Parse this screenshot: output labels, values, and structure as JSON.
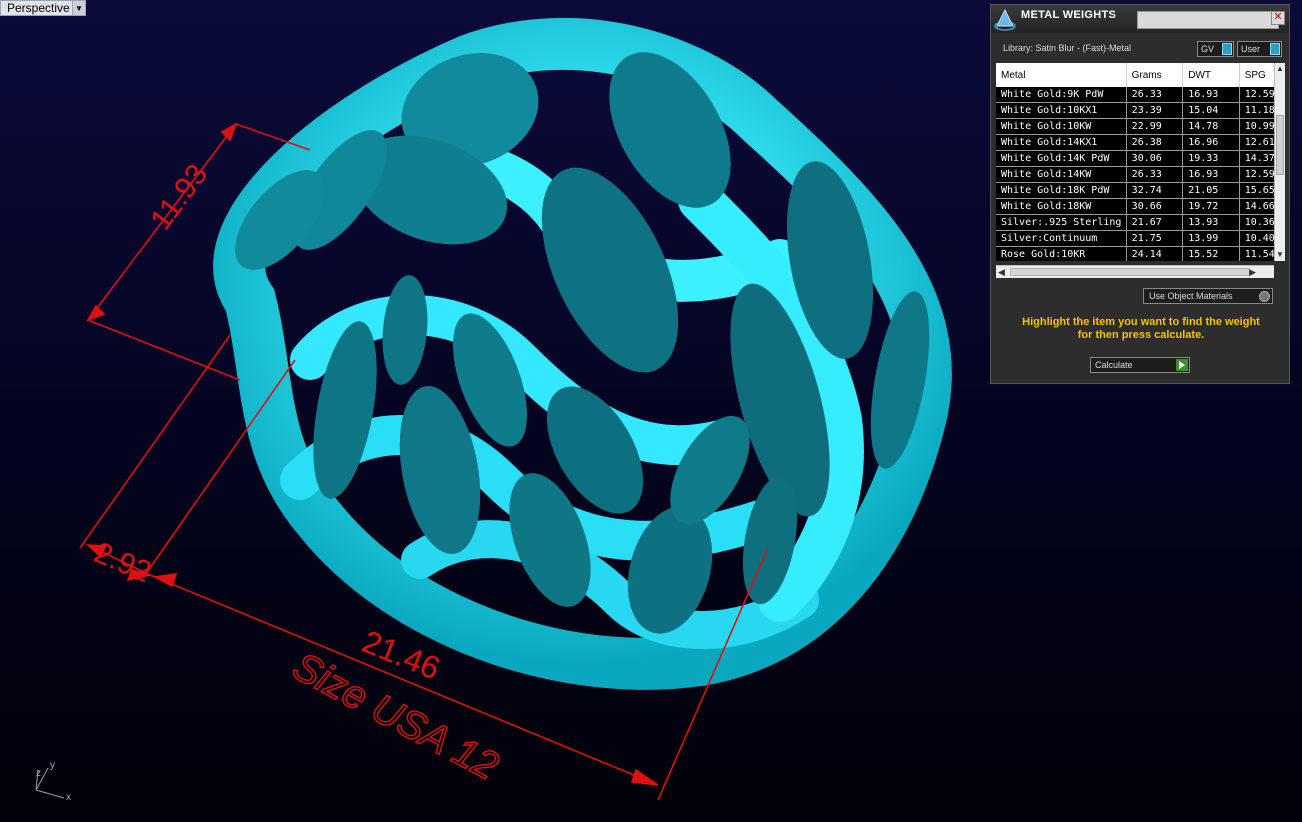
{
  "viewport": {
    "name": "Perspective",
    "dimensions": [
      "11.93",
      "2.92",
      "21.46"
    ],
    "size_note": "Size USA 12",
    "axes": {
      "x": "x",
      "y": "y",
      "z": "z"
    }
  },
  "panel": {
    "title": "METAL WEIGHTS",
    "close": "✕",
    "library": "Library: Satin Blur - (Fast)-Metal",
    "toggles": {
      "gv": "GV",
      "user": "User"
    },
    "table": {
      "headers": [
        "Metal",
        "Grams",
        "DWT",
        "SPG"
      ],
      "rows": [
        [
          "White Gold:9K PdW",
          "26.33",
          "16.93",
          "12.59"
        ],
        [
          "White Gold:10KX1",
          "23.39",
          "15.04",
          "11.18"
        ],
        [
          "White Gold:10KW",
          "22.99",
          "14.78",
          "10.99"
        ],
        [
          "White Gold:14KX1",
          "26.38",
          "16.96",
          "12.61"
        ],
        [
          "White Gold:14K PdW",
          "30.06",
          "19.33",
          "14.37"
        ],
        [
          "White Gold:14KW",
          "26.33",
          "16.93",
          "12.59"
        ],
        [
          "White Gold:18K PdW",
          "32.74",
          "21.05",
          "15.65"
        ],
        [
          "White Gold:18KW",
          "30.66",
          "19.72",
          "14.66"
        ],
        [
          "Silver:.925 Sterling",
          "21.67",
          "13.93",
          "10.36"
        ],
        [
          "Silver:Continuum",
          "21.75",
          "13.99",
          "10.40"
        ],
        [
          "Rose Gold:10KR",
          "24.14",
          "15.52",
          "11.54"
        ]
      ]
    },
    "use_object_materials": "Use Object Materials",
    "hint_line1": "Highlight the item you want to find the weight",
    "hint_line2": "for then press calculate.",
    "calculate": "Calculate"
  },
  "colors": {
    "ring_light": "#2ef0ff",
    "ring_flat": "#0f7f8f",
    "dimension": "#e01010",
    "hint": "#f5c400"
  }
}
